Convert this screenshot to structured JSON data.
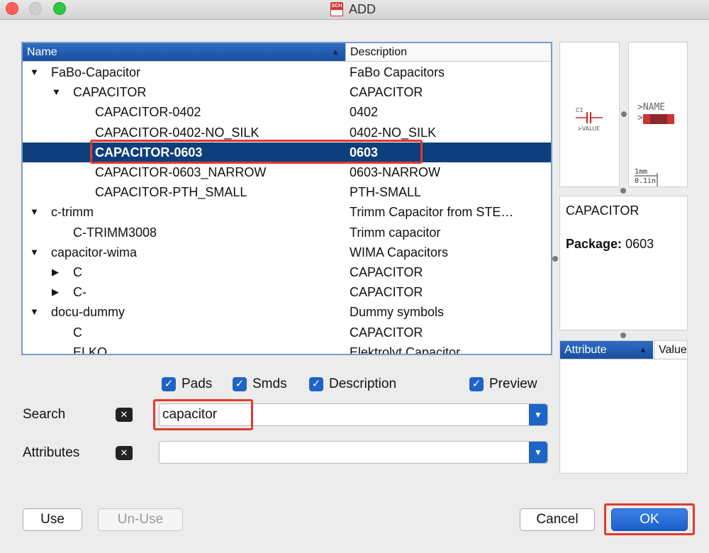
{
  "window": {
    "title": "ADD",
    "icon": "SCH"
  },
  "tree": {
    "headers": {
      "name": "Name",
      "description": "Description"
    },
    "rows": [
      {
        "arrow": "▼",
        "name": "FaBo-Capacitor",
        "desc": "FaBo Capacitors"
      },
      {
        "arrow": "▼",
        "name": "CAPACITOR",
        "desc": "CAPACITOR"
      },
      {
        "arrow": "",
        "name": "CAPACITOR-0402",
        "desc": "0402"
      },
      {
        "arrow": "",
        "name": "CAPACITOR-0402-NO_SILK",
        "desc": "0402-NO_SILK"
      },
      {
        "arrow": "",
        "name": "CAPACITOR-0603",
        "desc": "0603"
      },
      {
        "arrow": "",
        "name": "CAPACITOR-0603_NARROW",
        "desc": "0603-NARROW"
      },
      {
        "arrow": "",
        "name": "CAPACITOR-PTH_SMALL",
        "desc": "PTH-SMALL"
      },
      {
        "arrow": "▼",
        "name": "c-trimm",
        "desc": "Trimm Capacitor from STE…"
      },
      {
        "arrow": "",
        "name": "C-TRIMM3008",
        "desc": "Trimm capacitor"
      },
      {
        "arrow": "▼",
        "name": "capacitor-wima",
        "desc": "WIMA Capacitors"
      },
      {
        "arrow": "▶",
        "name": "C",
        "desc": "CAPACITOR"
      },
      {
        "arrow": "▶",
        "name": "C-",
        "desc": "CAPACITOR"
      },
      {
        "arrow": "▼",
        "name": "docu-dummy",
        "desc": "Dummy symbols"
      },
      {
        "arrow": "",
        "name": "C",
        "desc": "CAPACITOR"
      },
      {
        "arrow": "",
        "name": "ELKO",
        "desc": "Elektrolyt Capacitor"
      }
    ]
  },
  "preview": {
    "symbol_name": "C1",
    "symbol_value": ">VALUE",
    "package_name": ">NAME",
    "scale_top": "1mm",
    "scale_bottom": "0.1in"
  },
  "info": {
    "title": "CAPACITOR",
    "package_label": "Package:",
    "package_value": "0603"
  },
  "attributes_table": {
    "col_attr": "Attribute",
    "col_value": "Value"
  },
  "options": {
    "pads": "Pads",
    "smds": "Smds",
    "description": "Description",
    "preview": "Preview"
  },
  "search": {
    "label": "Search",
    "value": "capacitor"
  },
  "attributes": {
    "label": "Attributes",
    "value": ""
  },
  "buttons": {
    "use": "Use",
    "unuse": "Un-Use",
    "cancel": "Cancel",
    "ok": "OK"
  }
}
